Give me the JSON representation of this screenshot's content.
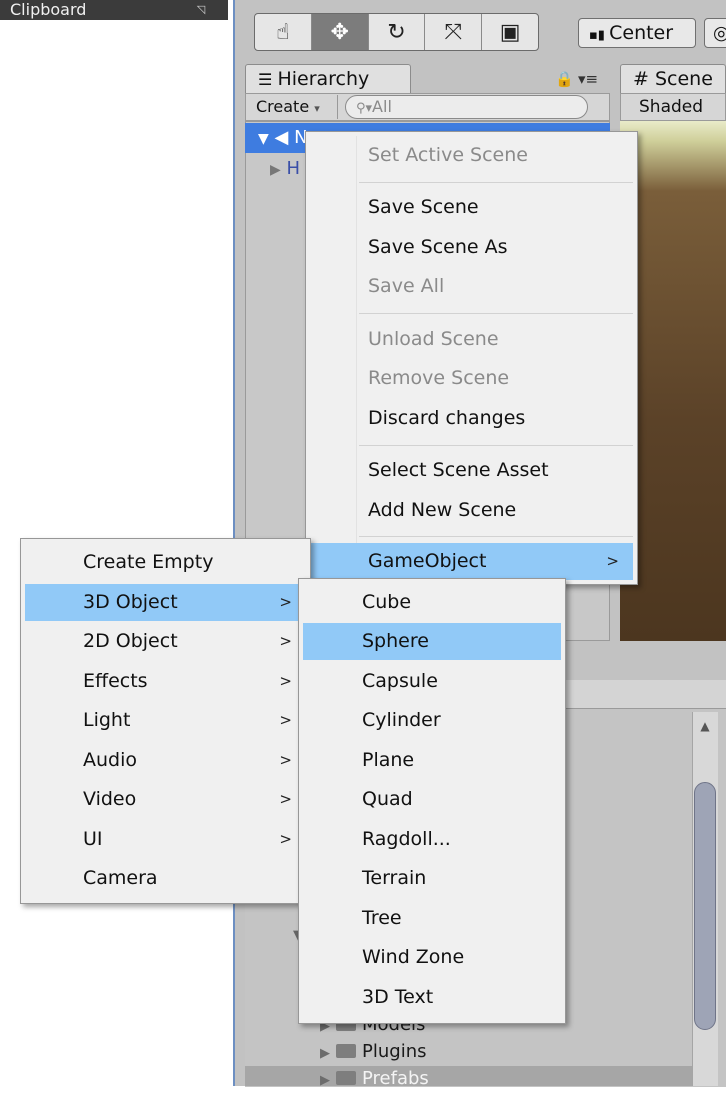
{
  "ribbon": {
    "title": "Clipboard"
  },
  "toolbar": {
    "tools": [
      {
        "name": "hand-tool-icon",
        "glyph": "☝"
      },
      {
        "name": "move-tool-icon",
        "glyph": "✥"
      },
      {
        "name": "rotate-tool-icon",
        "glyph": "↻"
      },
      {
        "name": "scale-tool-icon",
        "glyph": "⤧"
      },
      {
        "name": "rect-tool-icon",
        "glyph": "▣"
      }
    ],
    "pivot_label": "Center"
  },
  "hierarchy": {
    "tab_label": "Hierarchy",
    "create_label": "Create",
    "search_placeholder": "All",
    "scene_row_label": "N",
    "child_row_label": "H"
  },
  "scene": {
    "tab_label": "Scene",
    "shading_label": "Shaded"
  },
  "context_menu": {
    "items": [
      "Set Active Scene",
      "Save Scene",
      "Save Scene As",
      "Save All",
      "Unload Scene",
      "Remove Scene",
      "Discard changes",
      "Select Scene Asset",
      "Add New Scene",
      "GameObject"
    ]
  },
  "gameobject_menu": {
    "items": [
      "Create Empty",
      "3D Object",
      "2D Object",
      "Effects",
      "Light",
      "Audio",
      "Video",
      "UI",
      "Camera"
    ]
  },
  "object_menu": {
    "items": [
      "Cube",
      "Sphere",
      "Capsule",
      "Cylinder",
      "Plane",
      "Quad",
      "Ragdoll...",
      "Terrain",
      "Tree",
      "Wind Zone",
      "3D Text"
    ]
  },
  "project": {
    "folders": [
      "Models",
      "Plugins",
      "Prefabs"
    ]
  },
  "colors": {
    "highlight": "#91c9f7",
    "selection": "#3e7ce0"
  }
}
